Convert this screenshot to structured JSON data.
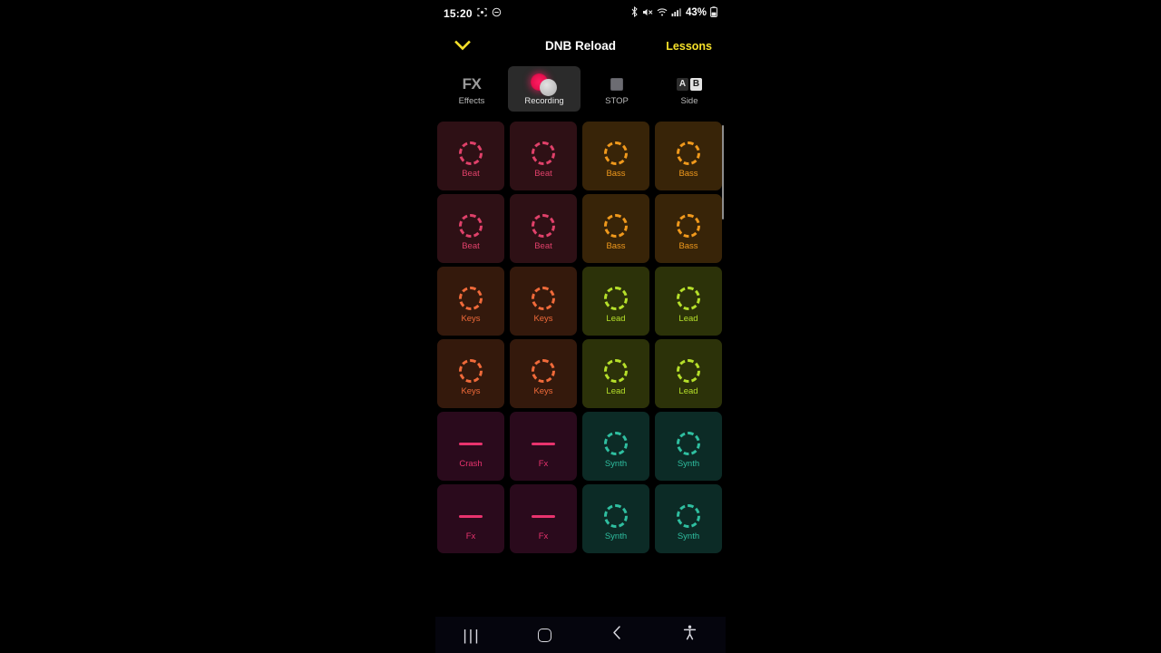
{
  "status_bar": {
    "time": "15:20",
    "left_icons": [
      "screenshot-capture-icon",
      "do-not-disturb-icon"
    ],
    "right_icons": [
      "bluetooth-icon",
      "volume-mute-icon",
      "wifi-icon",
      "cellular-signal-icon"
    ],
    "battery_percent": "43%"
  },
  "header": {
    "collapse_icon": "chevron-down-icon",
    "title": "DNB Reload",
    "lessons_label": "Lessons",
    "accent_color": "#f5e02a"
  },
  "toolbar": {
    "items": [
      {
        "icon": "fx-icon",
        "glyph": "FX",
        "label": "Effects",
        "active": false
      },
      {
        "icon": "record-icon",
        "label": "Recording",
        "active": true
      },
      {
        "icon": "stop-icon",
        "label": "STOP",
        "active": false
      },
      {
        "icon": "side-ab-icon",
        "glyph_a": "A",
        "glyph_b": "B",
        "label": "Side",
        "active": false
      }
    ]
  },
  "pad_grid": {
    "columns": 4,
    "scrollbar_visible": true,
    "pads": [
      {
        "label": "Beat",
        "icon": "dashed-circle-icon",
        "bg": "#2e1015",
        "fg": "#e0416a"
      },
      {
        "label": "Beat",
        "icon": "dashed-circle-icon",
        "bg": "#2e1015",
        "fg": "#e0416a"
      },
      {
        "label": "Bass",
        "icon": "dashed-circle-icon",
        "bg": "#382408",
        "fg": "#f0991c"
      },
      {
        "label": "Bass",
        "icon": "dashed-circle-icon",
        "bg": "#382408",
        "fg": "#f0991c"
      },
      {
        "label": "Beat",
        "icon": "dashed-circle-icon",
        "bg": "#2e1015",
        "fg": "#e0416a"
      },
      {
        "label": "Beat",
        "icon": "dashed-circle-icon",
        "bg": "#2e1015",
        "fg": "#e0416a"
      },
      {
        "label": "Bass",
        "icon": "dashed-circle-icon",
        "bg": "#382408",
        "fg": "#f0991c"
      },
      {
        "label": "Bass",
        "icon": "dashed-circle-icon",
        "bg": "#382408",
        "fg": "#f0991c"
      },
      {
        "label": "Keys",
        "icon": "dashed-circle-icon",
        "bg": "#34190c",
        "fg": "#f06a3a"
      },
      {
        "label": "Keys",
        "icon": "dashed-circle-icon",
        "bg": "#34190c",
        "fg": "#f06a3a"
      },
      {
        "label": "Lead",
        "icon": "dashed-circle-icon",
        "bg": "#2c3209",
        "fg": "#b6e02a"
      },
      {
        "label": "Lead",
        "icon": "dashed-circle-icon",
        "bg": "#2c3209",
        "fg": "#b6e02a"
      },
      {
        "label": "Keys",
        "icon": "dashed-circle-icon",
        "bg": "#34190c",
        "fg": "#f06a3a"
      },
      {
        "label": "Keys",
        "icon": "dashed-circle-icon",
        "bg": "#34190c",
        "fg": "#f06a3a"
      },
      {
        "label": "Lead",
        "icon": "dashed-circle-icon",
        "bg": "#2c3209",
        "fg": "#b6e02a"
      },
      {
        "label": "Lead",
        "icon": "dashed-circle-icon",
        "bg": "#2c3209",
        "fg": "#b6e02a"
      },
      {
        "label": "Crash",
        "icon": "dash-bar-icon",
        "bg": "#2a0a1c",
        "fg": "#e8336e"
      },
      {
        "label": "Fx",
        "icon": "dash-bar-icon",
        "bg": "#2a0a1c",
        "fg": "#e8336e"
      },
      {
        "label": "Synth",
        "icon": "dashed-circle-icon",
        "bg": "#0c2b26",
        "fg": "#2fbfa0"
      },
      {
        "label": "Synth",
        "icon": "dashed-circle-icon",
        "bg": "#0c2b26",
        "fg": "#2fbfa0"
      },
      {
        "label": "Fx",
        "icon": "dash-bar-icon",
        "bg": "#2a0a1c",
        "fg": "#e8336e"
      },
      {
        "label": "Fx",
        "icon": "dash-bar-icon",
        "bg": "#2a0a1c",
        "fg": "#e8336e"
      },
      {
        "label": "Synth",
        "icon": "dashed-circle-icon",
        "bg": "#0c2b26",
        "fg": "#2fbfa0"
      },
      {
        "label": "Synth",
        "icon": "dashed-circle-icon",
        "bg": "#0c2b26",
        "fg": "#2fbfa0"
      }
    ]
  },
  "nav_bar": {
    "buttons": [
      {
        "icon": "recents-icon",
        "glyph": "|||"
      },
      {
        "icon": "home-icon"
      },
      {
        "icon": "back-icon"
      },
      {
        "icon": "accessibility-icon"
      }
    ]
  }
}
